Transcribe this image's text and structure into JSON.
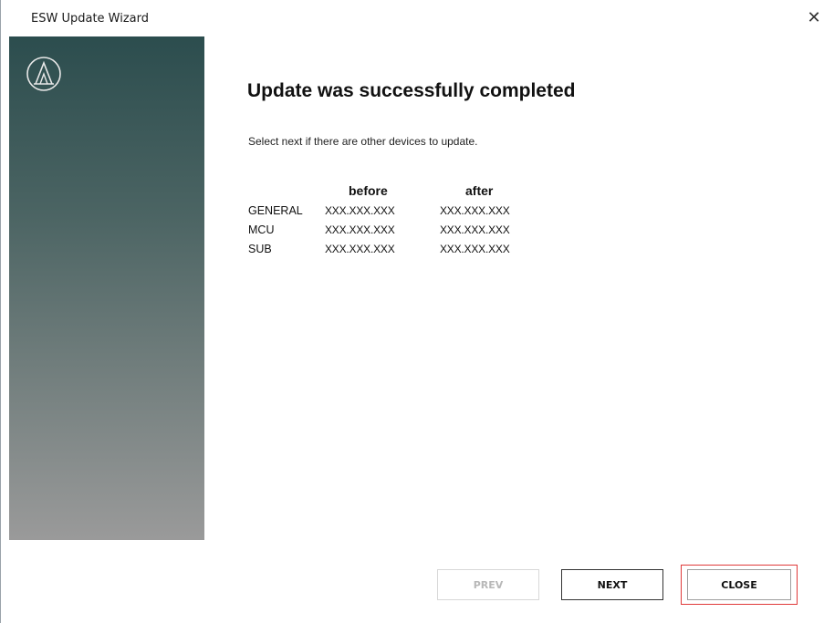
{
  "window": {
    "title": "ESW Update Wizard",
    "close_glyph": "✕"
  },
  "sidebar": {
    "logo_icon": "audio-technica-logo-icon",
    "gradient_top": "#2c4d4e",
    "gradient_bottom": "#9a9a9a"
  },
  "main": {
    "heading": "Update was successfully completed",
    "subtext": "Select next if there are other devices to update.",
    "versions": {
      "headers": {
        "label": "",
        "before": "before",
        "after": "after"
      },
      "rows": [
        {
          "label": "GENERAL",
          "before": "XXX.XXX.XXX",
          "after": "XXX.XXX.XXX"
        },
        {
          "label": "MCU",
          "before": "XXX.XXX.XXX",
          "after": "XXX.XXX.XXX"
        },
        {
          "label": "SUB",
          "before": "XXX.XXX.XXX",
          "after": "XXX.XXX.XXX"
        }
      ]
    }
  },
  "footer": {
    "prev_label": "PREV",
    "next_label": "NEXT",
    "close_label": "CLOSE",
    "highlight_color": "#e03a3a"
  }
}
